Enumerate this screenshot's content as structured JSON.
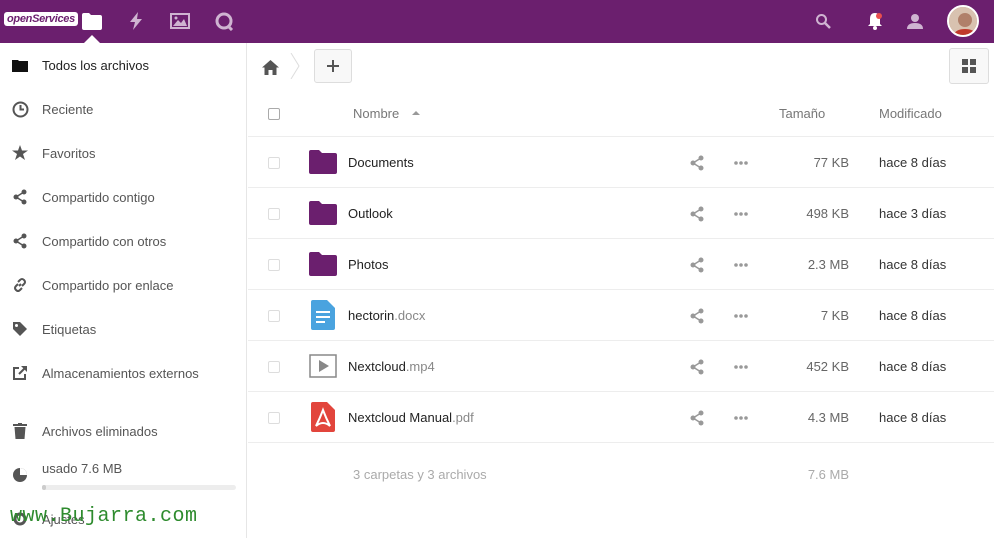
{
  "header": {
    "logo_text": "openServices",
    "brand_color": "#6b1f6e",
    "apps": [
      {
        "name": "files-icon"
      },
      {
        "name": "activity-icon"
      },
      {
        "name": "gallery-icon"
      },
      {
        "name": "talk-icon"
      }
    ]
  },
  "sidebar": {
    "items": [
      {
        "label": "Todos los archivos",
        "icon": "folder-icon"
      },
      {
        "label": "Reciente",
        "icon": "clock-icon"
      },
      {
        "label": "Favoritos",
        "icon": "star-icon"
      },
      {
        "label": "Compartido contigo",
        "icon": "share-icon"
      },
      {
        "label": "Compartido con otros",
        "icon": "share-icon"
      },
      {
        "label": "Compartido por enlace",
        "icon": "link-icon"
      },
      {
        "label": "Etiquetas",
        "icon": "tag-icon"
      },
      {
        "label": "Almacenamientos externos",
        "icon": "external-icon"
      }
    ],
    "deleted": "Archivos eliminados",
    "quota": {
      "label": "usado 7.6 MB",
      "fraction": 0.02
    },
    "settings": "Ajustes"
  },
  "watermark": "www.Bujarra.com",
  "table": {
    "headers": {
      "name": "Nombre",
      "size": "Tamaño",
      "modified": "Modificado"
    },
    "rows": [
      {
        "name": "Documents",
        "ext": "",
        "type": "folder",
        "size": "77 KB",
        "modified": "hace 8 días"
      },
      {
        "name": "Outlook",
        "ext": "",
        "type": "folder",
        "size": "498 KB",
        "modified": "hace 3 días"
      },
      {
        "name": "Photos",
        "ext": "",
        "type": "folder",
        "size": "2.3 MB",
        "modified": "hace 8 días"
      },
      {
        "name": "hectorin",
        "ext": ".docx",
        "type": "document",
        "size": "7 KB",
        "modified": "hace 8 días"
      },
      {
        "name": "Nextcloud",
        "ext": ".mp4",
        "type": "video",
        "size": "452 KB",
        "modified": "hace 8 días"
      },
      {
        "name": "Nextcloud Manual",
        "ext": ".pdf",
        "type": "pdf",
        "size": "4.3 MB",
        "modified": "hace 8 días"
      }
    ],
    "summary": "3 carpetas y 3 archivos",
    "summary_size": "7.6 MB"
  }
}
